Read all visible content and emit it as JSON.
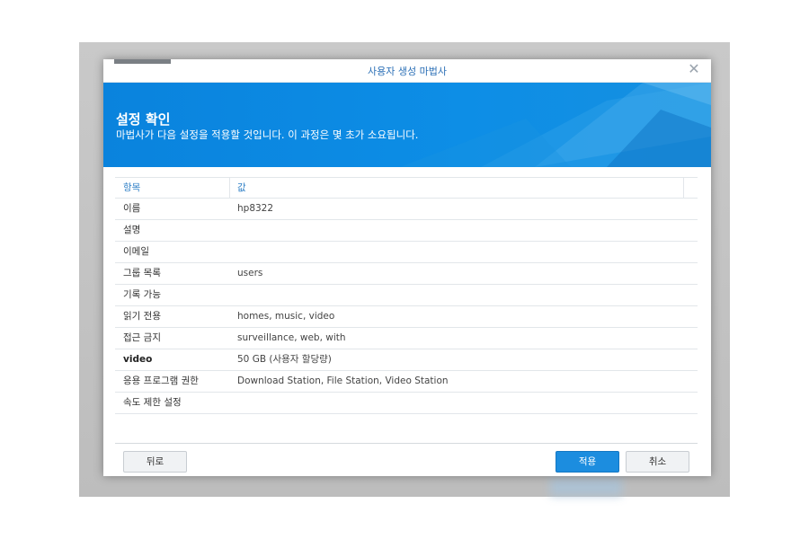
{
  "window": {
    "title": "사용자 생성 마법사",
    "close_glyph": "✕"
  },
  "banner": {
    "title": "설정 확인",
    "subtitle": "마법사가 다음 설정을 적용할 것입니다. 이 과정은 몇 초가 소요됩니다."
  },
  "table": {
    "headers": {
      "item": "항목",
      "value": "값"
    },
    "rows": [
      {
        "item": "이름",
        "value": "hp8322"
      },
      {
        "item": "설명",
        "value": ""
      },
      {
        "item": "이메일",
        "value": ""
      },
      {
        "item": "그룹 목록",
        "value": "users"
      },
      {
        "item": "기록 가능",
        "value": ""
      },
      {
        "item": "읽기 전용",
        "value": "homes, music, video"
      },
      {
        "item": "접근 금지",
        "value": "surveillance, web, with"
      },
      {
        "item": "video",
        "value": "50 GB (사용자 할당량)"
      },
      {
        "item": "응용 프로그램 권한",
        "value": "Download Station, File Station, Video Station"
      },
      {
        "item": "속도 제한 설정",
        "value": ""
      }
    ]
  },
  "buttons": {
    "back": "뒤로",
    "apply": "적용",
    "cancel": "취소"
  },
  "colors": {
    "accent": "#1c8ddf",
    "banner": "#0a83dd",
    "header_text": "#2f7fc6"
  }
}
